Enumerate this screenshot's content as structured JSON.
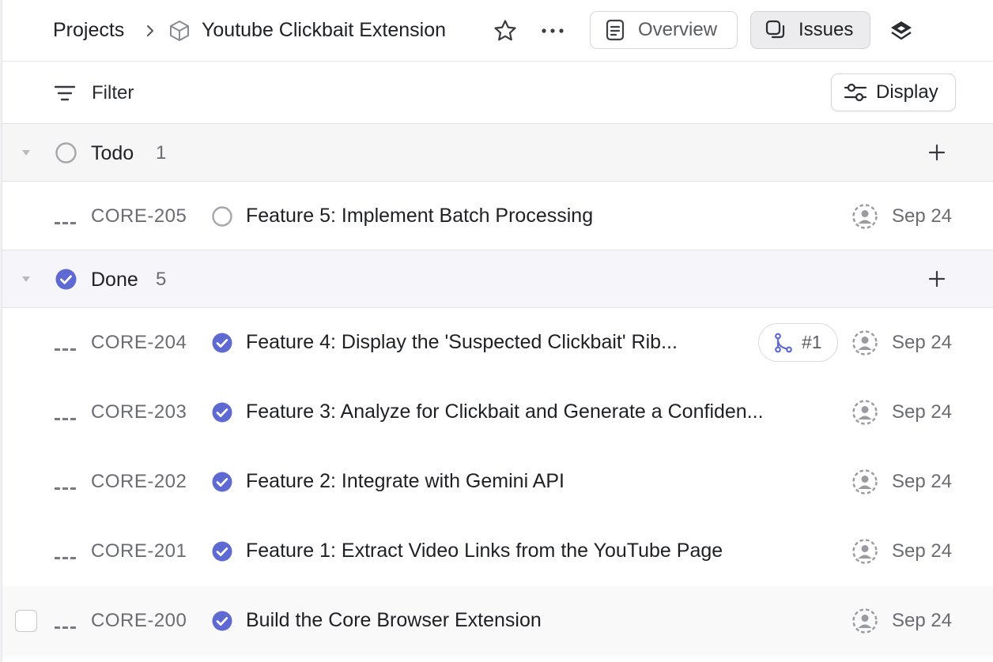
{
  "header": {
    "breadcrumb_root": "Projects",
    "project_name": "Youtube Clickbait Extension",
    "tabs": [
      {
        "label": "Overview",
        "icon": "document-icon",
        "active": false
      },
      {
        "label": "Issues",
        "icon": "issues-icon",
        "active": true
      }
    ]
  },
  "toolbar": {
    "filter_label": "Filter",
    "display_label": "Display"
  },
  "groups": [
    {
      "name": "Todo",
      "count": "1",
      "status": "todo",
      "issues": [
        {
          "id": "CORE-205",
          "title": "Feature 5: Implement Batch Processing",
          "date": "Sep 24"
        }
      ]
    },
    {
      "name": "Done",
      "count": "5",
      "status": "done",
      "issues": [
        {
          "id": "CORE-204",
          "title": "Feature 4: Display the 'Suspected Clickbait' Rib...",
          "date": "Sep 24",
          "pr": "#1"
        },
        {
          "id": "CORE-203",
          "title": "Feature 3: Analyze for Clickbait and Generate a Confiden...",
          "date": "Sep 24"
        },
        {
          "id": "CORE-202",
          "title": "Feature 2: Integrate with Gemini API",
          "date": "Sep 24"
        },
        {
          "id": "CORE-201",
          "title": "Feature 1: Extract Video Links from the YouTube Page",
          "date": "Sep 24"
        },
        {
          "id": "CORE-200",
          "title": "Build the Core Browser Extension",
          "date": "Sep 24"
        }
      ]
    }
  ],
  "colors": {
    "done": "#5e6ad2",
    "todo_ring": "#a6a6ad",
    "text": "#1f2024",
    "muted": "#6b6c73"
  }
}
